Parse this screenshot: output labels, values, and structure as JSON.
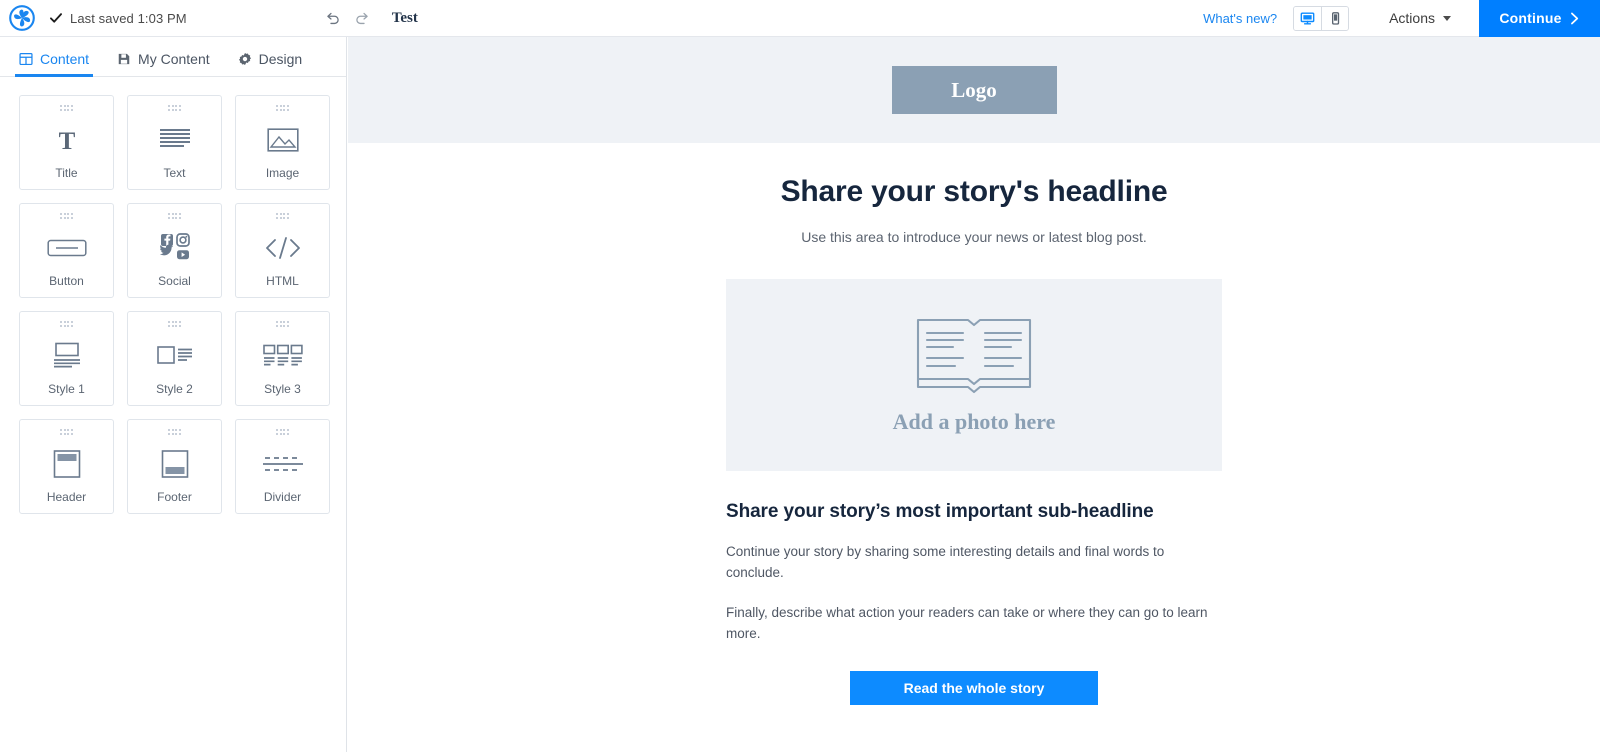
{
  "topbar": {
    "brand_icon": "pinwheel-logo-icon",
    "check_icon": "checkmark-icon",
    "saved_status": "Last saved 1:03 PM",
    "undo_icon": "undo-arrow-icon",
    "redo_icon": "redo-arrow-icon",
    "campaign_title": "Test",
    "whats_new": "What's new?",
    "device_desktop_icon": "desktop-monitor-icon",
    "device_mobile_icon": "mobile-phone-icon",
    "actions_label": "Actions",
    "actions_caret_icon": "chevron-down-icon",
    "continue_label": "Continue",
    "continue_chevron_icon": "chevron-right-icon",
    "accent_blue": "#007fff",
    "link_blue": "#1a86f0"
  },
  "sidebar": {
    "tabs": [
      {
        "label": "Content",
        "icon": "grid-layout-icon",
        "active": true
      },
      {
        "label": "My Content",
        "icon": "save-disk-icon",
        "active": false
      },
      {
        "label": "Design",
        "icon": "gear-icon",
        "active": false
      }
    ],
    "blocks": [
      {
        "label": "Title",
        "icon": "serif-letter-t-icon"
      },
      {
        "label": "Text",
        "icon": "text-lines-icon"
      },
      {
        "label": "Image",
        "icon": "picture-mountain-icon"
      },
      {
        "label": "Button",
        "icon": "rounded-button-icon"
      },
      {
        "label": "Social",
        "icon": "social-networks-icon"
      },
      {
        "label": "HTML",
        "icon": "code-brackets-icon"
      },
      {
        "label": "Style 1",
        "icon": "image-above-text-icon"
      },
      {
        "label": "Style 2",
        "icon": "image-beside-text-icon"
      },
      {
        "label": "Style 3",
        "icon": "three-column-icon"
      },
      {
        "label": "Header",
        "icon": "header-bar-icon"
      },
      {
        "label": "Footer",
        "icon": "footer-bar-icon"
      },
      {
        "label": "Divider",
        "icon": "dashed-divider-icon"
      }
    ]
  },
  "canvas": {
    "logo_placeholder": "Logo",
    "headline": "Share your story's headline",
    "subtext": "Use this area to introduce your news or latest blog post.",
    "photo_icon": "open-book-icon",
    "photo_caption": "Add a photo here",
    "subheadline": "Share your story’s most important sub-headline",
    "paragraph_1": "Continue your story by sharing some interesting details and final words to conclude.",
    "paragraph_2": "Finally, describe what action your readers can take or where they can go to learn more.",
    "cta_label": "Read the whole story",
    "band_bg": "#eff2f6",
    "logo_bg": "#8ba0b4",
    "cta_bg": "#0d8bff"
  }
}
